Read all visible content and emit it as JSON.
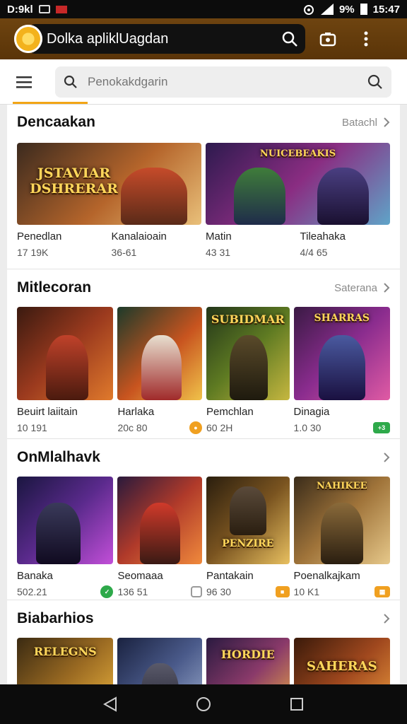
{
  "status": {
    "left_text": "D:9kl",
    "time": "15:47",
    "battery": "9%"
  },
  "app": {
    "title": "Dolka apliklUagdan"
  },
  "search": {
    "placeholder": "Penokakdgarin"
  },
  "sections": [
    {
      "title": "Dencaakan",
      "see_all": "Batachl",
      "items": [
        {
          "name": "Penedlan",
          "meta": "17 19K",
          "art_title": "JSTAVIAR DSHRERAR",
          "colors": [
            "#3b2a1e",
            "#b5652b",
            "#e9c07a"
          ],
          "badge": null
        },
        {
          "name": "Kanalaioain",
          "meta": "36-61",
          "art_title": "",
          "colors": [
            "#2a1530",
            "#6f2a64",
            "#3f7d3a"
          ],
          "badge": null
        },
        {
          "name": "Matin",
          "meta": "43 31",
          "art_title": "NUICEBEAKIS",
          "colors": [
            "#2d1a4e",
            "#8a2d82",
            "#5fa4c8"
          ],
          "badge": null
        },
        {
          "name": "Tileahaka",
          "meta": "4/4 65",
          "art_title": "",
          "colors": [
            "#1f2c4a",
            "#4a3f82",
            "#7fb0d6"
          ],
          "badge": null
        }
      ]
    },
    {
      "title": "Mitlecoran",
      "see_all": "Saterana",
      "items": [
        {
          "name": "Beuirt laiitain",
          "meta": "10 191",
          "art_title": "",
          "colors": [
            "#3a1a10",
            "#9b3a1e",
            "#e07a2c"
          ],
          "badge": null
        },
        {
          "name": "Harlaka",
          "meta": "20c 80",
          "art_title": "",
          "colors": [
            "#1c3a2a",
            "#c8541f",
            "#f0c24a"
          ],
          "badge": {
            "color": "#f0a020",
            "icon": "coin-icon"
          }
        },
        {
          "name": "Pemchlan",
          "meta": "60 2H",
          "art_title": "SUBIDMAR",
          "colors": [
            "#23361a",
            "#5e7a22",
            "#c6b740"
          ],
          "badge": null
        },
        {
          "name": "Dinagia",
          "meta": "1.0 30",
          "art_title": "SHARRAS",
          "colors": [
            "#3a1a44",
            "#8a2c8e",
            "#e05ba4"
          ],
          "badge": {
            "color": "#2ea94a",
            "icon": "plus-icon"
          }
        }
      ]
    },
    {
      "title": "OnMlalhavk",
      "see_all": "",
      "items": [
        {
          "name": "Banaka",
          "meta": "502.21",
          "art_title": "",
          "colors": [
            "#1a1640",
            "#5a2a8c",
            "#c24fd8"
          ],
          "badge": {
            "color": "#2ea94a",
            "icon": "leaf-icon"
          }
        },
        {
          "name": "Seomaaa",
          "meta": "136 51",
          "art_title": "",
          "colors": [
            "#2a1a3c",
            "#b03a2a",
            "#f08a3c"
          ],
          "badge": {
            "color": "#9a9a9a",
            "icon": "square-icon"
          }
        },
        {
          "name": "Pantakain",
          "meta": "96 30",
          "art_title": "PENZIRE",
          "colors": [
            "#2a1e0e",
            "#7a5420",
            "#e8c060"
          ],
          "badge": {
            "color": "#f0a020",
            "icon": "box-icon"
          }
        },
        {
          "name": "Poenalkajkam",
          "meta": "10 K1",
          "art_title": "NAHIKEE",
          "colors": [
            "#3a2c1a",
            "#a0743a",
            "#e6c88a"
          ],
          "badge": {
            "color": "#f0a020",
            "icon": "grid-icon"
          }
        }
      ]
    },
    {
      "title": "Biabarhios",
      "see_all": "",
      "items": [
        {
          "name": "",
          "meta": "",
          "art_title": "RELEGNS",
          "colors": [
            "#3a2a12",
            "#9a6a22",
            "#f0b840"
          ],
          "badge": null
        },
        {
          "name": "",
          "meta": "",
          "art_title": "",
          "colors": [
            "#1a2240",
            "#4a5a8a",
            "#a0b0d0"
          ],
          "badge": null
        },
        {
          "name": "",
          "meta": "",
          "art_title": "HORDIE",
          "colors": [
            "#2a1a40",
            "#8a3a6a",
            "#f0b040"
          ],
          "badge": null
        },
        {
          "name": "",
          "meta": "",
          "art_title": "SAHERAS",
          "colors": [
            "#3a1a0a",
            "#a0481e",
            "#f0a040"
          ],
          "badge": null
        }
      ]
    }
  ]
}
